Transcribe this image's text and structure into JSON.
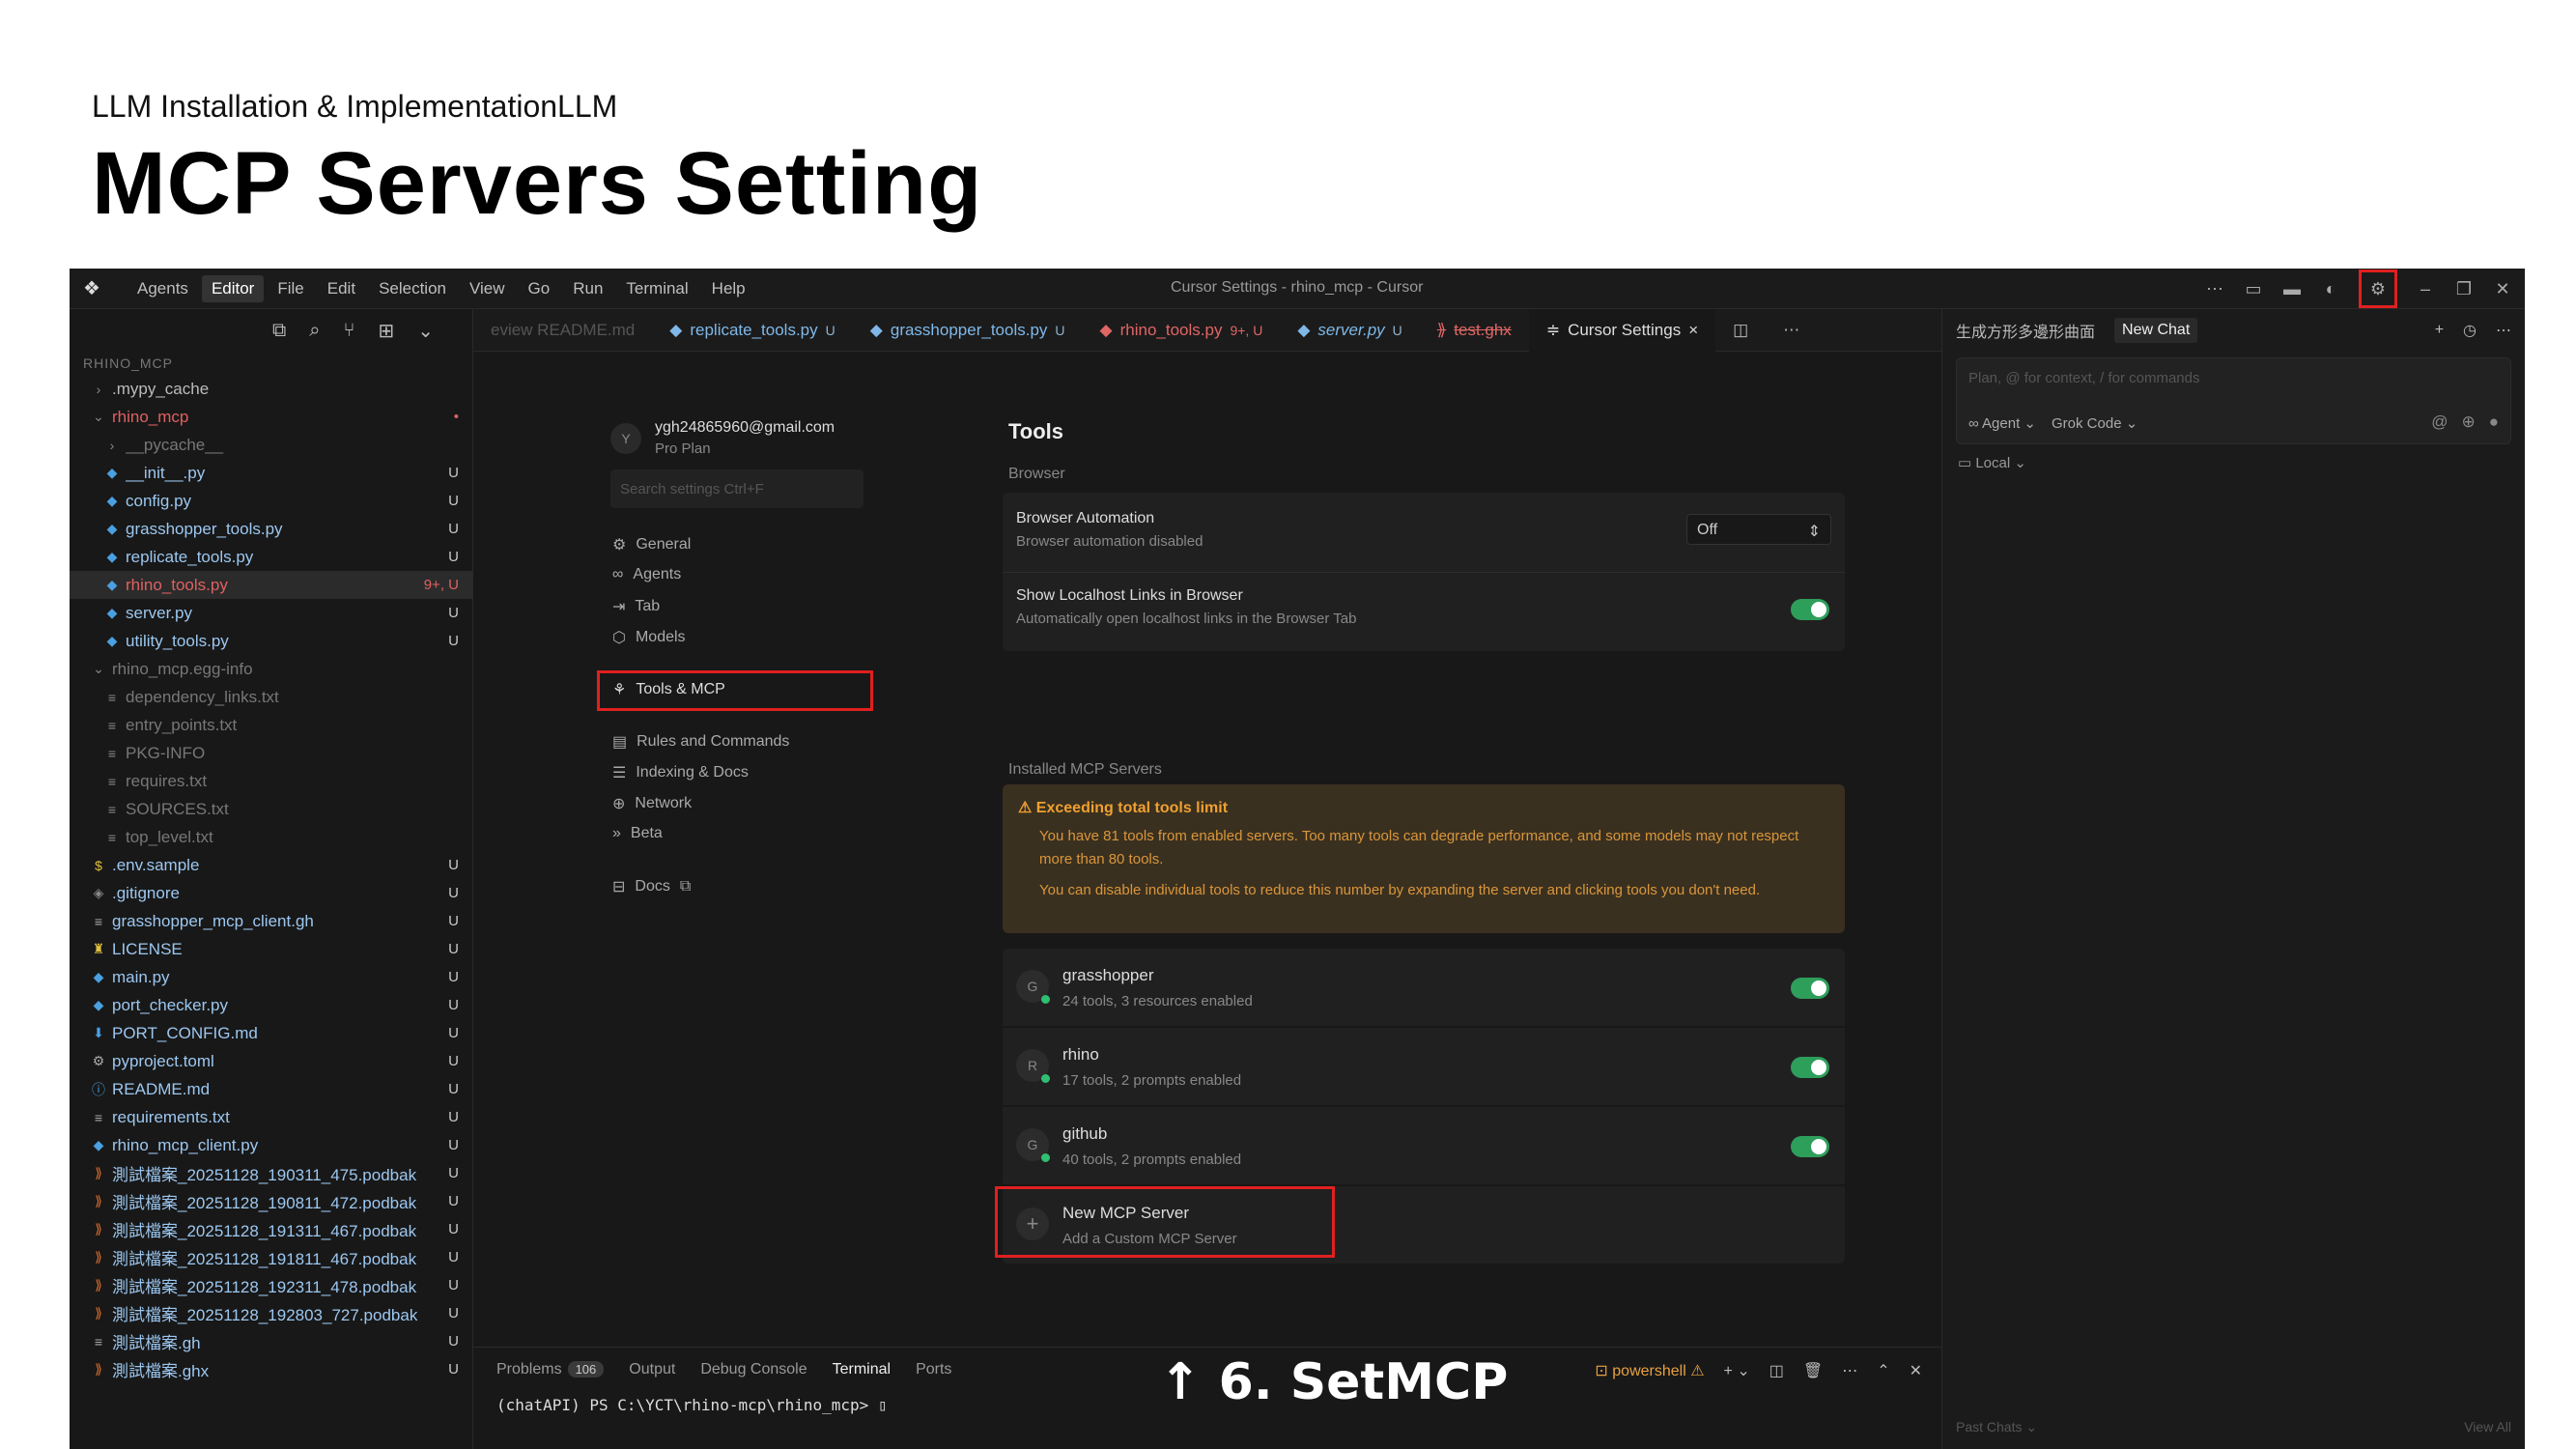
{
  "slide": {
    "subtitle": "LLM Installation & ImplementationLLM",
    "title": "MCP Servers Setting"
  },
  "titlebar": {
    "menu": [
      "Agents",
      "Editor",
      "File",
      "Edit",
      "Selection",
      "View",
      "Go",
      "Run",
      "Terminal",
      "Help"
    ],
    "window_title": "Cursor Settings - rhino_mcp - Cursor"
  },
  "explorer": {
    "root": "RHINO_MCP",
    "items": [
      {
        "name": ".mypy_cache",
        "status": ""
      },
      {
        "name": "rhino_mcp",
        "status": "•"
      },
      {
        "name": "__pycache__",
        "status": ""
      },
      {
        "name": "__init__.py",
        "status": "U"
      },
      {
        "name": "config.py",
        "status": "U"
      },
      {
        "name": "grasshopper_tools.py",
        "status": "U"
      },
      {
        "name": "replicate_tools.py",
        "status": "U"
      },
      {
        "name": "rhino_tools.py",
        "status": "9+, U"
      },
      {
        "name": "server.py",
        "status": "U"
      },
      {
        "name": "utility_tools.py",
        "status": "U"
      },
      {
        "name": "rhino_mcp.egg-info",
        "status": ""
      },
      {
        "name": "dependency_links.txt",
        "status": ""
      },
      {
        "name": "entry_points.txt",
        "status": ""
      },
      {
        "name": "PKG-INFO",
        "status": ""
      },
      {
        "name": "requires.txt",
        "status": ""
      },
      {
        "name": "SOURCES.txt",
        "status": ""
      },
      {
        "name": "top_level.txt",
        "status": ""
      },
      {
        "name": ".env.sample",
        "status": "U"
      },
      {
        "name": ".gitignore",
        "status": "U"
      },
      {
        "name": "grasshopper_mcp_client.gh",
        "status": "U"
      },
      {
        "name": "LICENSE",
        "status": "U"
      },
      {
        "name": "main.py",
        "status": "U"
      },
      {
        "name": "port_checker.py",
        "status": "U"
      },
      {
        "name": "PORT_CONFIG.md",
        "status": "U"
      },
      {
        "name": "pyproject.toml",
        "status": "U"
      },
      {
        "name": "README.md",
        "status": "U"
      },
      {
        "name": "requirements.txt",
        "status": "U"
      },
      {
        "name": "rhino_mcp_client.py",
        "status": "U"
      },
      {
        "name": "測試檔案_20251128_190311_475.podbak",
        "status": "U"
      },
      {
        "name": "測試檔案_20251128_190811_472.podbak",
        "status": "U"
      },
      {
        "name": "測試檔案_20251128_191311_467.podbak",
        "status": "U"
      },
      {
        "name": "測試檔案_20251128_191811_467.podbak",
        "status": "U"
      },
      {
        "name": "測試檔案_20251128_192311_478.podbak",
        "status": "U"
      },
      {
        "name": "測試檔案_20251128_192803_727.podbak",
        "status": "U"
      },
      {
        "name": "測試檔案.gh",
        "status": "U"
      },
      {
        "name": "測試檔案.ghx",
        "status": "U"
      }
    ]
  },
  "tabs": [
    {
      "label": "eview README.md",
      "status": ""
    },
    {
      "label": "replicate_tools.py",
      "status": "U"
    },
    {
      "label": "grasshopper_tools.py",
      "status": "U"
    },
    {
      "label": "rhino_tools.py",
      "status": "9+, U"
    },
    {
      "label": "server.py",
      "status": "U"
    },
    {
      "label": "test.ghx",
      "status": ""
    },
    {
      "label": "Cursor Settings",
      "status": "×"
    }
  ],
  "settings": {
    "account_email": "ygh24865960@gmail.com",
    "account_plan": "Pro Plan",
    "avatar_letter": "Y",
    "search_placeholder": "Search settings Ctrl+F",
    "nav": [
      "General",
      "Agents",
      "Tab",
      "Models",
      "Tools & MCP",
      "Rules and Commands",
      "Indexing & Docs",
      "Network",
      "Beta",
      "Docs"
    ],
    "heading": "Tools",
    "browser_label": "Browser",
    "browser_auto_title": "Browser Automation",
    "browser_auto_desc": "Browser automation disabled",
    "browser_auto_value": "Off",
    "localhost_title": "Show Localhost Links in Browser",
    "localhost_desc": "Automatically open localhost links in the Browser Tab",
    "installed_label": "Installed MCP Servers",
    "warning_title": "Exceeding total tools limit",
    "warning_text1": "You have 81 tools from enabled servers. Too many tools can degrade performance, and some models may not respect more than 80 tools.",
    "warning_text2": "You can disable individual tools to reduce this number by expanding the server and clicking tools you don't need.",
    "servers": [
      {
        "letter": "G",
        "name": "grasshopper",
        "desc": "24 tools, 3 resources enabled"
      },
      {
        "letter": "R",
        "name": "rhino",
        "desc": "17 tools, 2 prompts enabled"
      },
      {
        "letter": "G",
        "name": "github",
        "desc": "40 tools, 2 prompts enabled"
      }
    ],
    "new_server_title": "New MCP Server",
    "new_server_desc": "Add a Custom MCP Server"
  },
  "chat": {
    "history_title": "生成方形多邊形曲面",
    "new_chat": "New Chat",
    "placeholder": "Plan, @ for context, / for commands",
    "agent": "Agent",
    "model": "Grok Code",
    "local": "Local",
    "past_chats": "Past Chats",
    "view_all": "View All"
  },
  "panel": {
    "tabs": [
      "Problems",
      "Output",
      "Debug Console",
      "Terminal",
      "Ports"
    ],
    "problems_count": "106",
    "prompt": "(chatAPI) PS C:\\YCT\\rhino-mcp\\rhino_mcp> ",
    "annotation": "↑ 6. SetMCP",
    "shell": "powershell"
  }
}
